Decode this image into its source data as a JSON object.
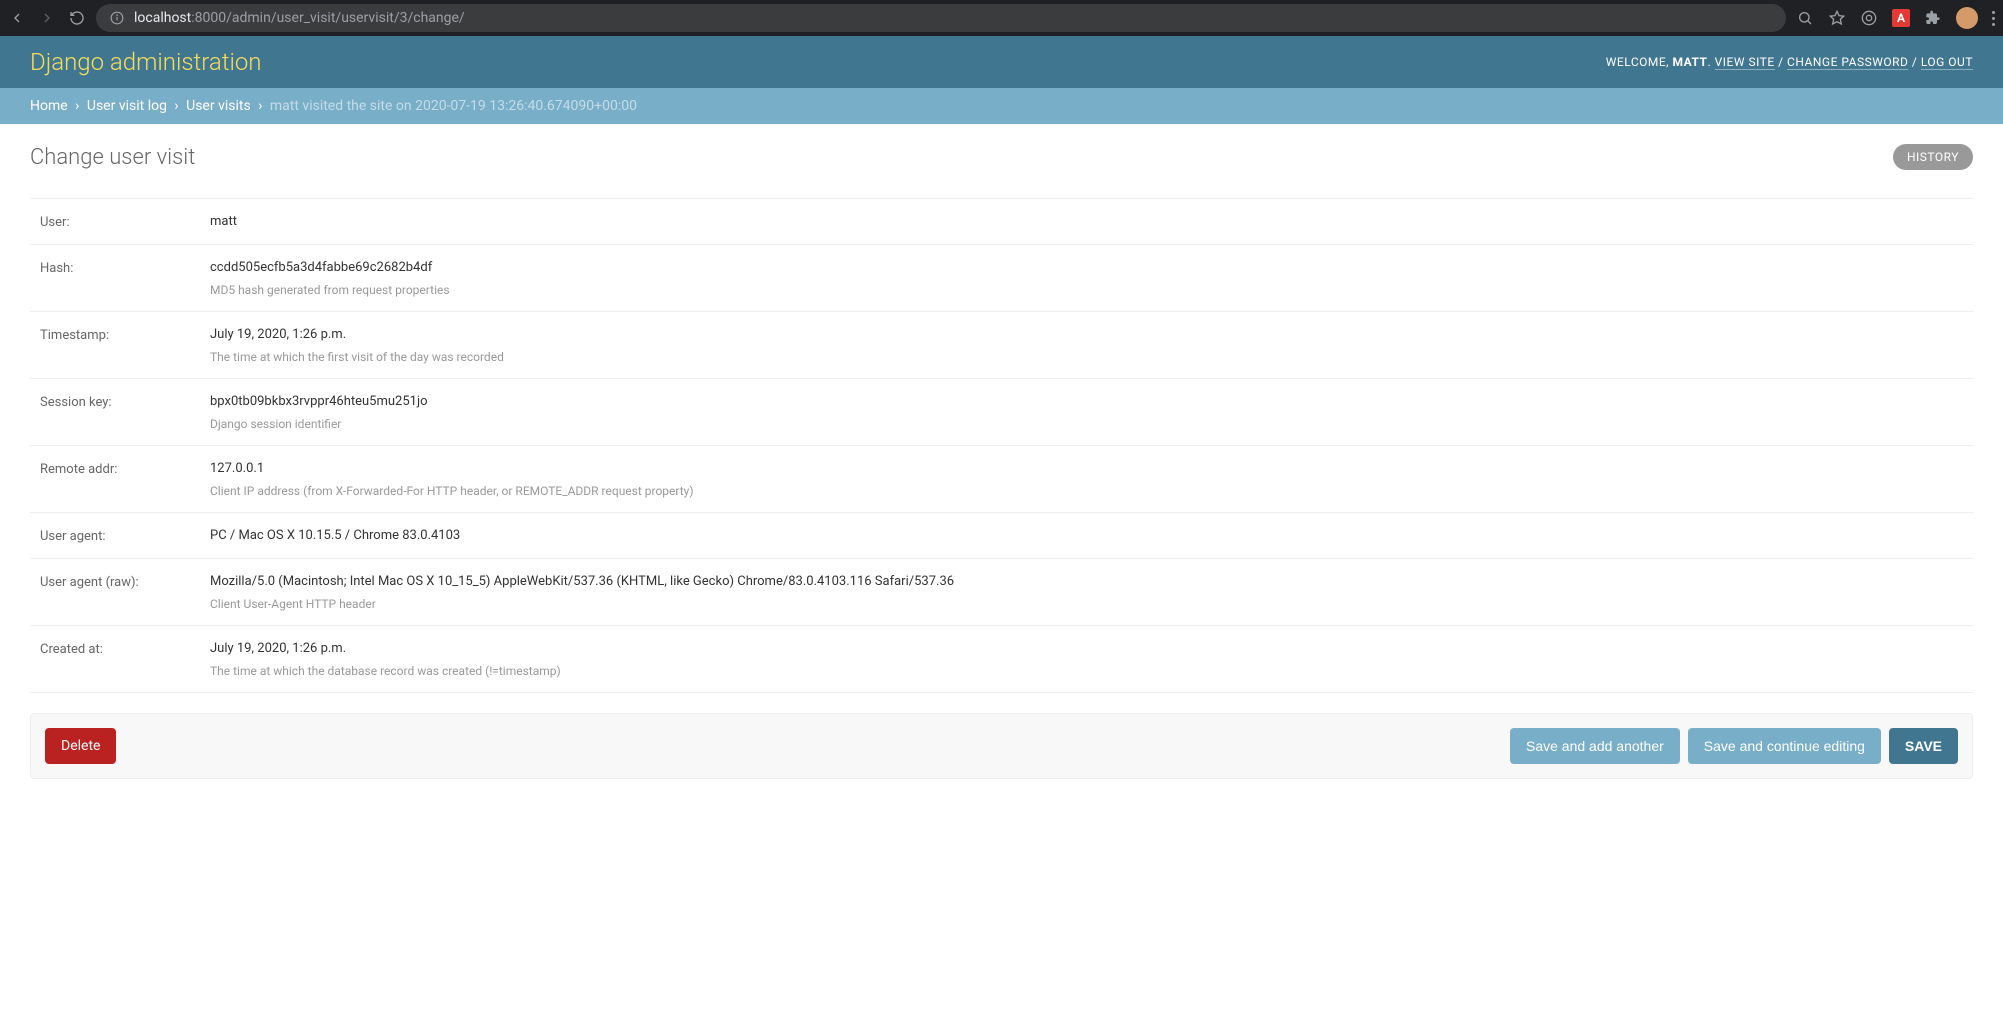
{
  "browser": {
    "url_host": "localhost",
    "url_path": ":8000/admin/user_visit/uservisit/3/change/"
  },
  "header": {
    "site_name": "Django administration",
    "welcome": "WELCOME,",
    "username": "MATT",
    "view_site": "VIEW SITE",
    "change_password": "CHANGE PASSWORD",
    "logout": "LOG OUT"
  },
  "breadcrumbs": {
    "home": "Home",
    "app": "User visit log",
    "model": "User visits",
    "current": "matt visited the site on 2020-07-19 13:26:40.674090+00:00"
  },
  "page": {
    "title": "Change user visit",
    "history": "HISTORY"
  },
  "fields": [
    {
      "label": "User:",
      "value": "matt",
      "help": ""
    },
    {
      "label": "Hash:",
      "value": "ccdd505ecfb5a3d4fabbe69c2682b4df",
      "help": "MD5 hash generated from request properties"
    },
    {
      "label": "Timestamp:",
      "value": "July 19, 2020, 1:26 p.m.",
      "help": "The time at which the first visit of the day was recorded"
    },
    {
      "label": "Session key:",
      "value": "bpx0tb09bkbx3rvppr46hteu5mu251jo",
      "help": "Django session identifier"
    },
    {
      "label": "Remote addr:",
      "value": "127.0.0.1",
      "help": "Client IP address (from X-Forwarded-For HTTP header, or REMOTE_ADDR request property)"
    },
    {
      "label": "User agent:",
      "value": "PC / Mac OS X 10.15.5 / Chrome 83.0.4103",
      "help": ""
    },
    {
      "label": "User agent (raw):",
      "value": "Mozilla/5.0 (Macintosh; Intel Mac OS X 10_15_5) AppleWebKit/537.36 (KHTML, like Gecko) Chrome/83.0.4103.116 Safari/537.36",
      "help": "Client User-Agent HTTP header"
    },
    {
      "label": "Created at:",
      "value": "July 19, 2020, 1:26 p.m.",
      "help": "The time at which the database record was created (!=timestamp)"
    }
  ],
  "submit": {
    "delete": "Delete",
    "save_add": "Save and add another",
    "save_continue": "Save and continue editing",
    "save": "SAVE"
  }
}
